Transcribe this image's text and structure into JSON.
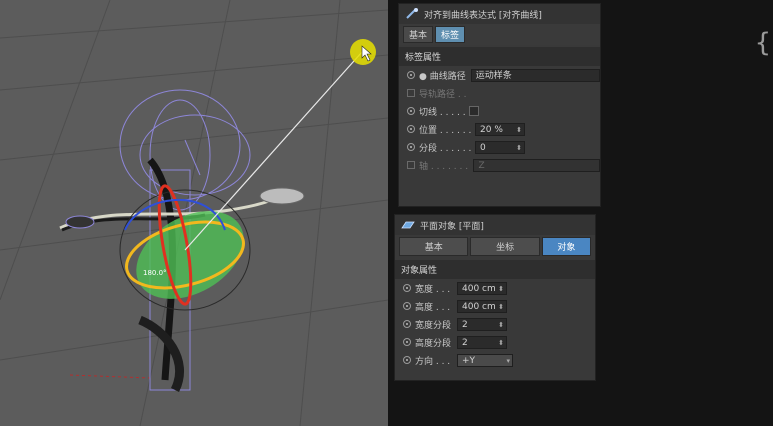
{
  "viewport": {
    "angle_label": "180.0°"
  },
  "tag_panel": {
    "title": "对齐到曲线表达式 [对齐曲线]",
    "tabs": [
      "基本",
      "标签"
    ],
    "active_tab": 1,
    "section": "标签属性",
    "rows": [
      {
        "label": "● 曲线路径",
        "value": "运动样条"
      },
      {
        "label": "导轨路径 . .",
        "value": ""
      },
      {
        "label": "切线 . . . . . .",
        "value": ""
      },
      {
        "label": "位置 . . . . . .",
        "value": "20 %"
      },
      {
        "label": "分段 . . . . . .",
        "value": "0"
      },
      {
        "label": "轴 . . . . . . . .",
        "value": "Z"
      }
    ]
  },
  "plane_panel": {
    "title": "平面对象 [平面]",
    "tabs": [
      "基本",
      "坐标",
      "对象"
    ],
    "active_tab": 2,
    "section": "对象属性",
    "rows": [
      {
        "label": "宽度 . . .",
        "value": "400 cm"
      },
      {
        "label": "高度 . . .",
        "value": "400 cm"
      },
      {
        "label": "宽度分段",
        "value": "2"
      },
      {
        "label": "高度分段",
        "value": "2"
      },
      {
        "label": "方向 . . .",
        "value": "+Y"
      }
    ]
  },
  "colors": {
    "viewport_bg": "#5c5c5c",
    "accent": "#4a86c2",
    "cursor": "#e8e000"
  }
}
